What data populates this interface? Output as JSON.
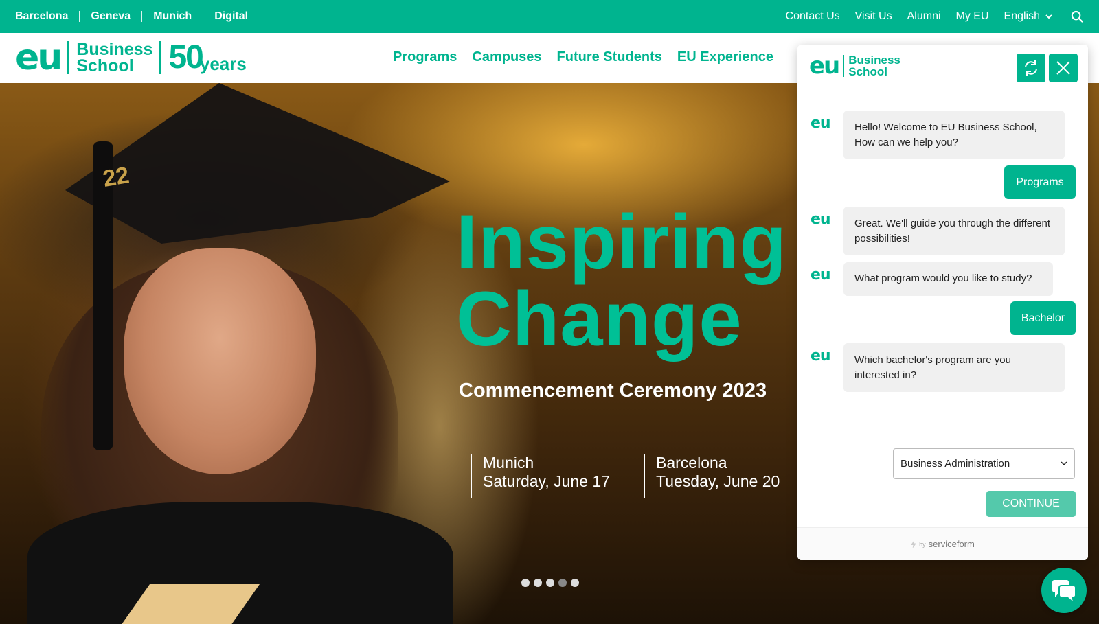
{
  "topbar": {
    "campuses": [
      "Barcelona",
      "Geneva",
      "Munich",
      "Digital"
    ],
    "links": [
      "Contact Us",
      "Visit Us",
      "Alumni",
      "My EU"
    ],
    "language": "English"
  },
  "header": {
    "logo_mark": "eu",
    "logo_line1": "Business",
    "logo_line2": "School",
    "anniversary_number": "50",
    "anniversary_word": "years",
    "nav": [
      "Programs",
      "Campuses",
      "Future Students",
      "EU Experience"
    ]
  },
  "hero": {
    "headline_line1": "Inspiring",
    "headline_line2": "Change",
    "subheading": "Commencement Ceremony 2023",
    "events": [
      {
        "city": "Munich",
        "date": "Saturday, June 17"
      },
      {
        "city": "Barcelona",
        "date": "Tuesday, June 20"
      }
    ],
    "slider": {
      "count": 5,
      "active_index": 3
    },
    "cap_tag": "22"
  },
  "chat": {
    "logo_mark": "eu",
    "logo_line1": "Business",
    "logo_line2": "School",
    "avatar_text": "eu",
    "messages": [
      {
        "from": "bot",
        "text": "Hello! Welcome to EU Business School, How can we help you?"
      },
      {
        "from": "user",
        "text": "Programs"
      },
      {
        "from": "bot",
        "text": "Great. We'll guide you through the different possibilities!"
      },
      {
        "from": "bot",
        "text": "What program would you like to study?"
      },
      {
        "from": "user",
        "text": "Bachelor"
      },
      {
        "from": "bot",
        "text": "Which bachelor's program are you interested in?"
      }
    ],
    "program_select_value": "Business Administration",
    "continue_label": "CONTINUE",
    "footer_by": "by",
    "footer_brand": "serviceform"
  },
  "colors": {
    "brand_green": "#00b48f",
    "headline_green": "#00c096",
    "continue_disabled": "#54c9ab",
    "apply_red": "#e4513b"
  }
}
